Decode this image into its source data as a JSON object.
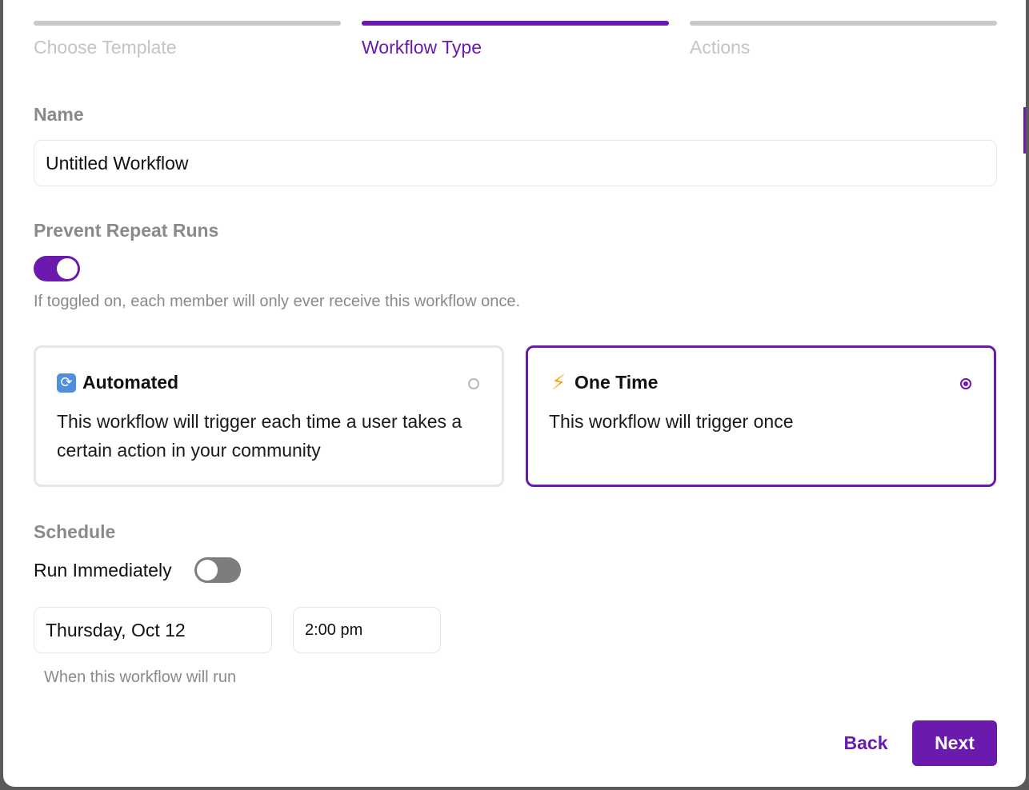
{
  "steps": [
    {
      "label": "Choose Template",
      "active": false
    },
    {
      "label": "Workflow Type",
      "active": true
    },
    {
      "label": "Actions",
      "active": false
    }
  ],
  "name": {
    "label": "Name",
    "value": "Untitled Workflow"
  },
  "prevent_repeat": {
    "label": "Prevent Repeat Runs",
    "enabled": true,
    "hint": "If toggled on, each member will only ever receive this workflow once."
  },
  "workflow_types": [
    {
      "icon": "repeat-icon",
      "title": "Automated",
      "description": "This workflow will trigger each time a user takes a certain action in your community",
      "selected": false
    },
    {
      "icon": "lightning-icon",
      "title": "One Time",
      "description": "This workflow will trigger once",
      "selected": true
    }
  ],
  "schedule": {
    "label": "Schedule",
    "run_immediately_label": "Run Immediately",
    "run_immediately": false,
    "date": "Thursday, Oct 12",
    "time": "2:00 pm",
    "helper": "When this workflow will run"
  },
  "footer": {
    "back_label": "Back",
    "next_label": "Next"
  },
  "colors": {
    "accent": "#6a1bad",
    "toggle_off": "#7d7d7d",
    "muted_text": "#8a8a8a"
  }
}
